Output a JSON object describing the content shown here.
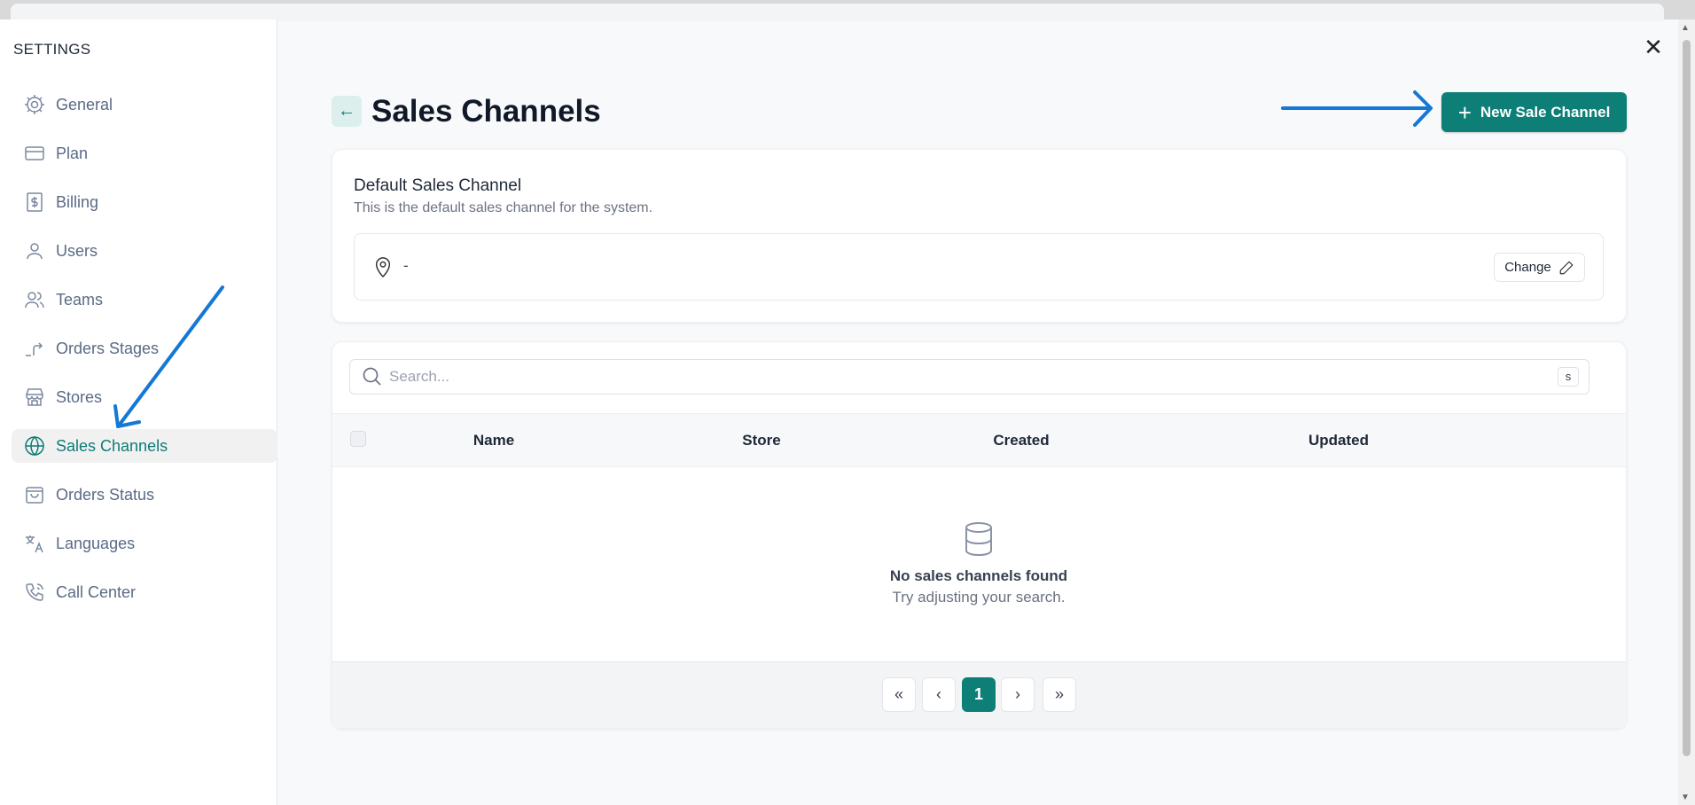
{
  "sidebar": {
    "title": "SETTINGS",
    "items": [
      {
        "label": "General",
        "icon": "gear-icon"
      },
      {
        "label": "Plan",
        "icon": "credit-card-icon"
      },
      {
        "label": "Billing",
        "icon": "dollar-receipt-icon"
      },
      {
        "label": "Users",
        "icon": "user-icon"
      },
      {
        "label": "Teams",
        "icon": "users-icon"
      },
      {
        "label": "Orders Stages",
        "icon": "stages-icon"
      },
      {
        "label": "Stores",
        "icon": "store-icon"
      },
      {
        "label": "Sales Channels",
        "icon": "globe-icon",
        "active": true
      },
      {
        "label": "Orders Status",
        "icon": "shopping-bag-icon"
      },
      {
        "label": "Languages",
        "icon": "translate-icon"
      },
      {
        "label": "Call Center",
        "icon": "phone-icon"
      }
    ]
  },
  "header": {
    "title": "Sales Channels",
    "new_button": "New Sale Channel",
    "close": "✕",
    "back": "←"
  },
  "default_card": {
    "title": "Default Sales Channel",
    "subtitle": "This is the default sales channel for the system.",
    "value": "-",
    "change_button": "Change"
  },
  "table": {
    "search_placeholder": "Search...",
    "shortcut": "s",
    "columns": [
      "Name",
      "Store",
      "Created",
      "Updated"
    ],
    "empty_title": "No sales channels found",
    "empty_subtitle": "Try adjusting your search."
  },
  "pagination": {
    "first": "«",
    "prev": "‹",
    "current": "1",
    "next": "›",
    "last": "»"
  },
  "colors": {
    "accent": "#0e7f77",
    "annotation": "#1478d4"
  }
}
